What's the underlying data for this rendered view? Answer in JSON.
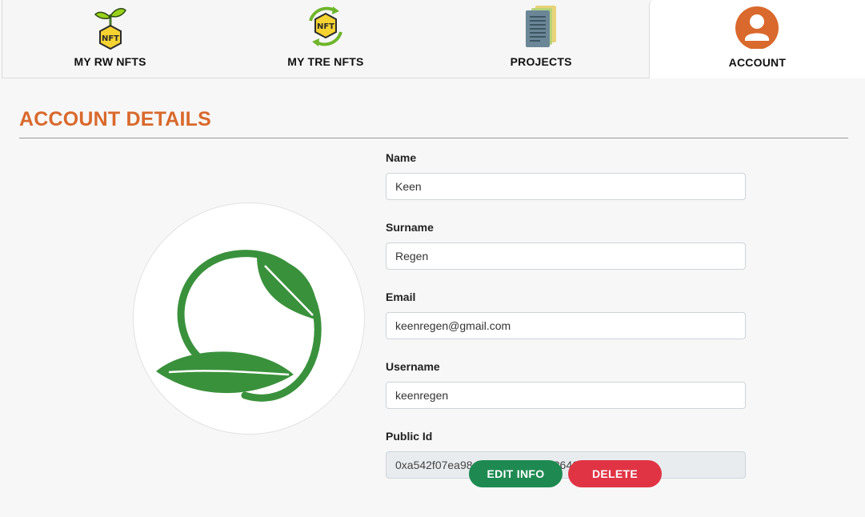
{
  "tabs": [
    {
      "label": "MY RW NFTS",
      "icon": "nft-sprout-icon",
      "active": false
    },
    {
      "label": "MY TRE NFTS",
      "icon": "nft-cycle-icon",
      "active": false
    },
    {
      "label": "PROJECTS",
      "icon": "documents-icon",
      "active": false
    },
    {
      "label": "ACCOUNT",
      "icon": "user-avatar-icon",
      "active": true
    }
  ],
  "icon_badge_text": "NFT",
  "account": {
    "title": "ACCOUNT DETAILS",
    "avatar_icon": "leaf-logo-icon",
    "fields": [
      {
        "label": "Name",
        "value": "Keen"
      },
      {
        "label": "Surname",
        "value": "Regen"
      },
      {
        "label": "Email",
        "value": "keenregen@gmail.com"
      },
      {
        "label": "Username",
        "value": "keenregen"
      },
      {
        "label": "Public Id",
        "value": "0xa542f07ea98d4e7a2e3be21486465f36f8a52474",
        "readonly": true
      }
    ],
    "edit_label": "EDIT INFO",
    "delete_label": "DELETE"
  },
  "colors": {
    "accent": "#d9692c",
    "edit": "#1e8a52",
    "delete": "#e03445",
    "leaf": "#3a913c"
  }
}
